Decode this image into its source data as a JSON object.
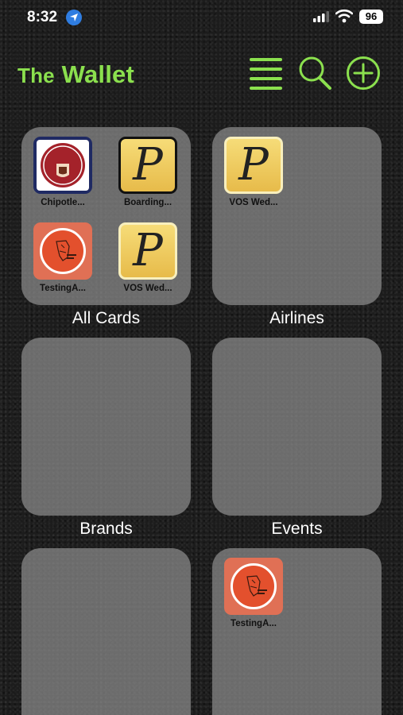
{
  "status_bar": {
    "time": "8:32",
    "battery": "96"
  },
  "header": {
    "title_small": "The",
    "title_main": "Wallet"
  },
  "folders": [
    {
      "label": "All Cards",
      "cards": [
        {
          "name": "Chipotle...",
          "icon": "chipotle-logo"
        },
        {
          "name": "Boarding...",
          "icon": "p-pass-icon"
        },
        {
          "name": "TestingA...",
          "icon": "testing-logo"
        },
        {
          "name": "VOS Wed...",
          "icon": "p-pass-icon"
        }
      ]
    },
    {
      "label": "Airlines",
      "cards": [
        {
          "name": "VOS Wed...",
          "icon": "p-pass-icon"
        }
      ]
    },
    {
      "label": "Brands",
      "cards": []
    },
    {
      "label": "Events",
      "cards": []
    },
    {
      "label": "",
      "cards": []
    },
    {
      "label": "",
      "cards": [
        {
          "name": "TestingA...",
          "icon": "testing-logo"
        }
      ]
    }
  ],
  "colors": {
    "accent": "#8be04e",
    "folder_bg": "#8c8c8c",
    "location": "#2f7de1"
  }
}
